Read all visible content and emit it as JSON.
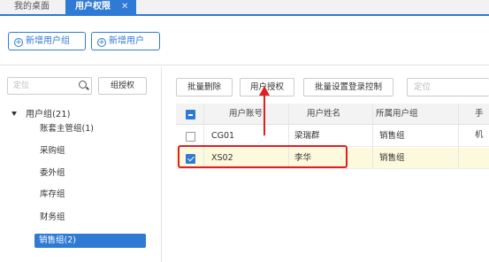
{
  "tabs": {
    "home_label": "我的桌面",
    "active_label": "用户权限",
    "close_glyph": "✕"
  },
  "topbar": {
    "add_group_label": "新增用户组",
    "add_user_label": "新增用户"
  },
  "sidebar": {
    "search_placeholder": "定位",
    "grant_group_label": "组授权",
    "tree_root_label": "用户组(21)",
    "items": [
      {
        "label": "账套主管组(1)"
      },
      {
        "label": "采购组"
      },
      {
        "label": "委外组"
      },
      {
        "label": "库存组"
      },
      {
        "label": "财务组"
      },
      {
        "label": "销售组(2)",
        "active": true
      }
    ]
  },
  "toolbar": {
    "batch_delete_label": "批量删除",
    "user_perm_label": "用户授权",
    "batch_login_label": "批量设置登录控制",
    "locate_placeholder": "定位"
  },
  "table": {
    "columns": [
      "用户账号",
      "用户姓名",
      "所属用户组",
      "手机"
    ],
    "rows": [
      {
        "account": "CG01",
        "name": "梁瑞群",
        "group": "销售组",
        "checked": false,
        "selected": false
      },
      {
        "account": "XS02",
        "name": "李华",
        "group": "销售组",
        "checked": true,
        "selected": true
      }
    ]
  },
  "colors": {
    "accent": "#2f7ad4",
    "highlight_row": "#fdf9dc",
    "annotation_red": "#e02020"
  }
}
